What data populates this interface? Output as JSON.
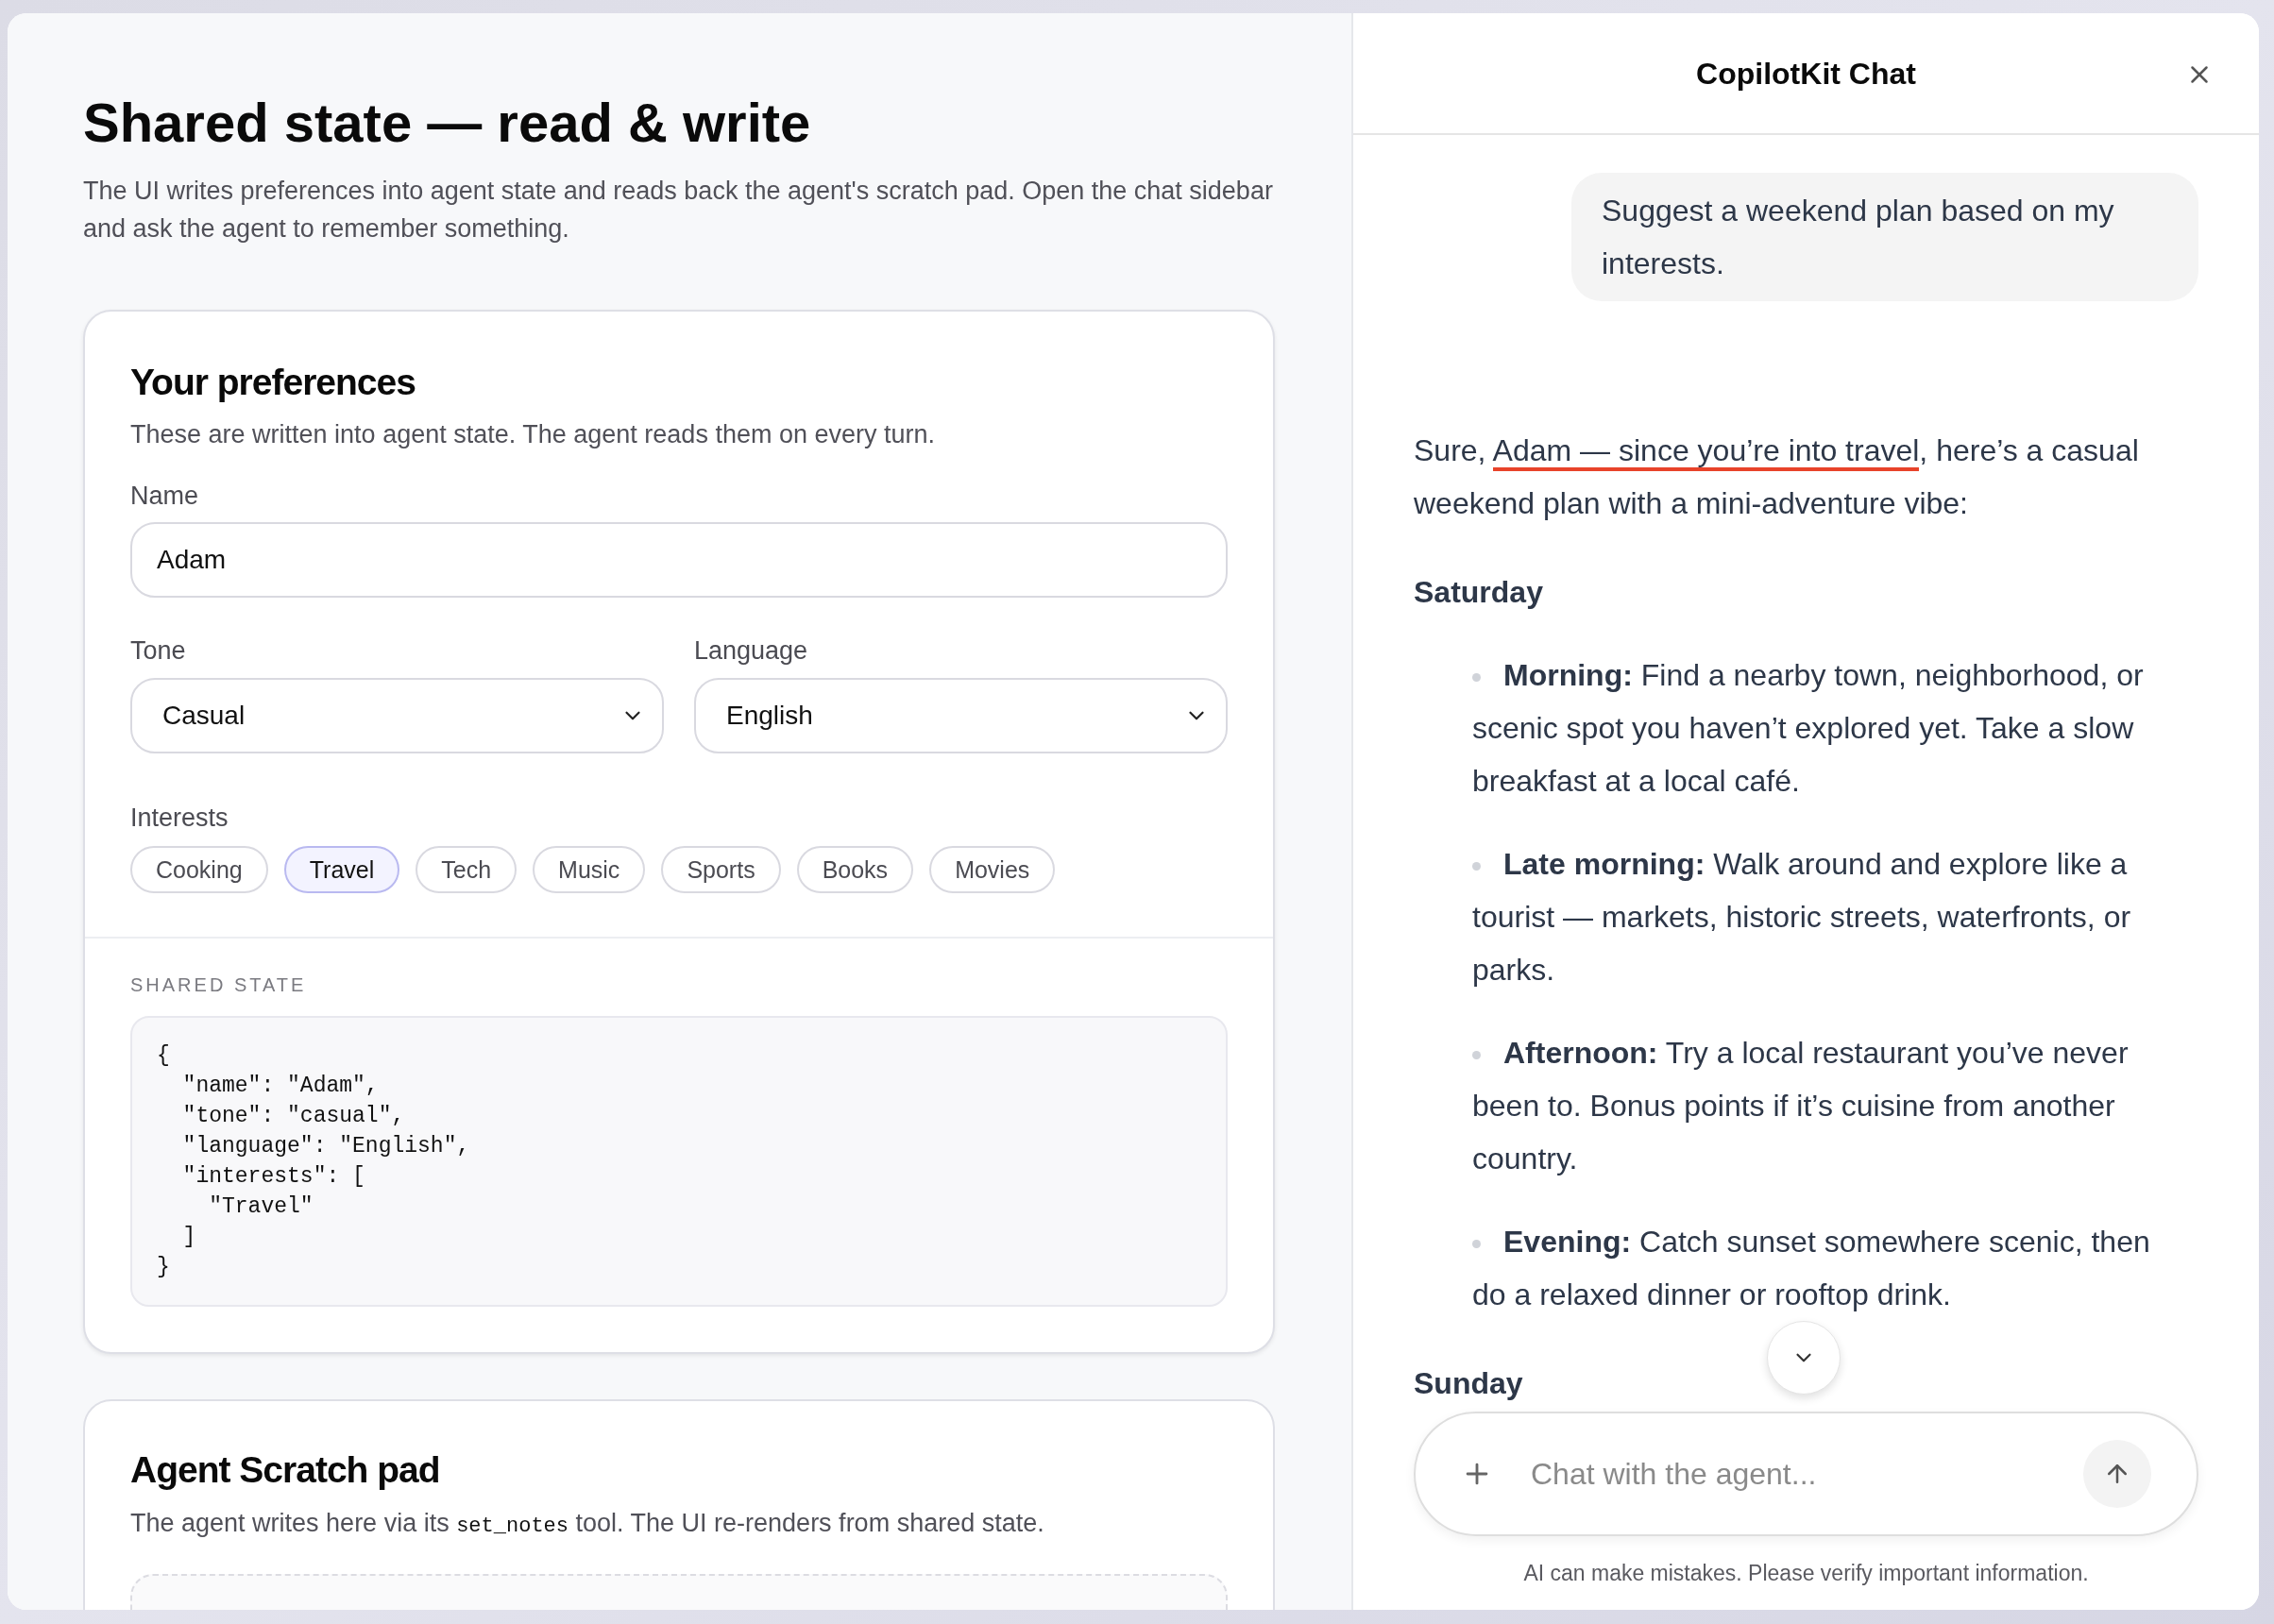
{
  "page": {
    "title": "Shared state — read & write",
    "description": "The UI writes preferences into agent state and reads back the agent's scratch pad. Open the chat sidebar and ask the agent to remember something."
  },
  "preferences": {
    "title": "Your preferences",
    "description": "These are written into agent state. The agent reads them on every turn.",
    "fields": [
      {
        "kind": "text",
        "label": "Name",
        "value": "Adam"
      },
      {
        "kind": "select",
        "label": "Tone",
        "value": "Casual"
      },
      {
        "kind": "select",
        "label": "Language",
        "value": "English"
      }
    ],
    "interests_label": "Interests",
    "interests": [
      {
        "label": "Cooking",
        "selected": false
      },
      {
        "label": "Travel",
        "selected": true
      },
      {
        "label": "Tech",
        "selected": false
      },
      {
        "label": "Music",
        "selected": false
      },
      {
        "label": "Sports",
        "selected": false
      },
      {
        "label": "Books",
        "selected": false
      },
      {
        "label": "Movies",
        "selected": false
      }
    ]
  },
  "shared_state": {
    "label": "SHARED STATE",
    "code": "{\n  \"name\": \"Adam\",\n  \"tone\": \"casual\",\n  \"language\": \"English\",\n  \"interests\": [\n    \"Travel\"\n  ]\n}"
  },
  "scratch_pad": {
    "title": "Agent Scratch pad",
    "description": [
      {
        "kind": "text",
        "text": "The agent writes here via its "
      },
      {
        "kind": "code",
        "text": "set_notes"
      },
      {
        "kind": "text",
        "text": " tool. The UI re-renders from shared state."
      }
    ]
  },
  "chat": {
    "title": "CopilotKit Chat",
    "user_message": {
      "text": "Suggest a weekend plan based on my interests."
    },
    "assistant_message": {
      "blocks": [
        {
          "kind": "paragraph",
          "segments": [
            {
              "text": "Sure, ",
              "underlined": false
            },
            {
              "text": "Adam — since you’re into travel",
              "underlined": true
            },
            {
              "text": ", here’s a casual weekend plan with a mini-adventure vibe:",
              "underlined": false
            }
          ]
        },
        {
          "kind": "heading",
          "text": "Saturday"
        },
        {
          "kind": "bullet",
          "text": "**Morning:** Find a nearby town, neighborhood, or scenic spot you haven’t explored yet. Take a slow breakfast at a local café."
        },
        {
          "kind": "bullet",
          "text": "**Late morning:** Walk around and explore like a tourist — markets, historic streets, waterfronts, or parks."
        },
        {
          "kind": "bullet",
          "text": "**Afternoon:** Try a local restaurant you’ve never been to. Bonus points if it’s cuisine from another country."
        },
        {
          "kind": "bullet",
          "text": "**Evening:** Catch sunset somewhere scenic, then do a relaxed dinner or rooftop drink."
        },
        {
          "kind": "heading",
          "text": "Sunday"
        }
      ]
    },
    "input": {
      "placeholder": "Chat with the agent..."
    },
    "disclaimer": "AI can make mistakes. Please verify important information."
  }
}
